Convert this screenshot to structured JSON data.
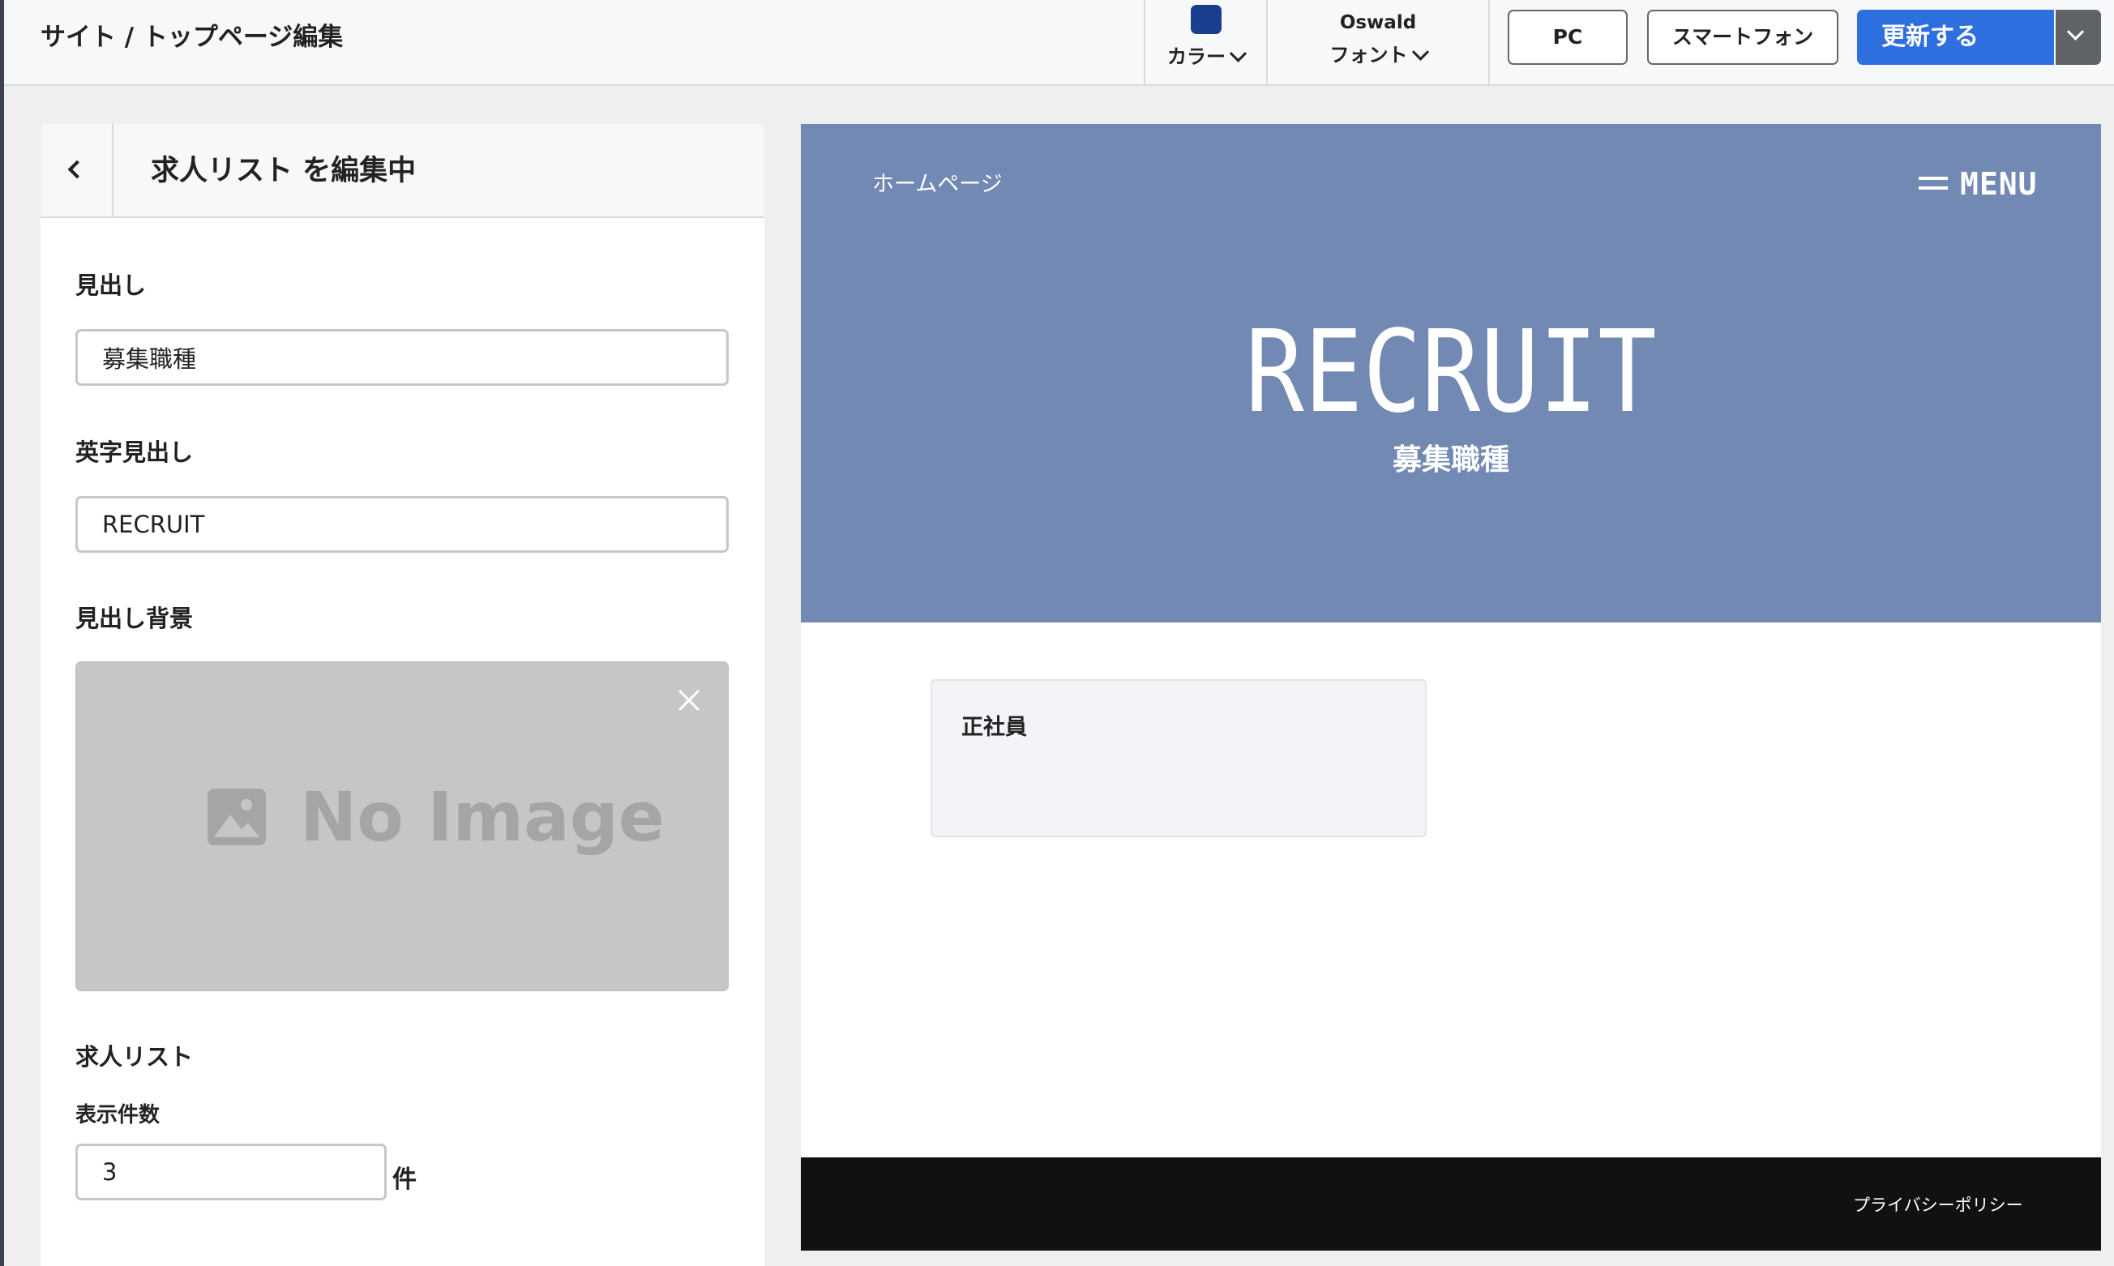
{
  "toolbar": {
    "breadcrumb": "サイト / トップページ編集",
    "color_label": "カラー",
    "color_swatch": "#1b3f8f",
    "font_name": "Oswald",
    "font_label": "フォント",
    "pc_label": "PC",
    "smartphone_label": "スマートフォン",
    "update_label": "更新する",
    "accent_color": "#2e6fe0"
  },
  "panel": {
    "title": "求人リスト を編集中",
    "heading_label": "見出し",
    "heading_value": "募集職種",
    "english_heading_label": "英字見出し",
    "english_heading_value": "RECRUIT",
    "background_label": "見出し背景",
    "no_image_text": "No Image",
    "list_label": "求人リスト",
    "count_label": "表示件数",
    "count_value": "3",
    "count_unit": "件"
  },
  "preview": {
    "home_link": "ホームページ",
    "menu_label": "MENU",
    "title": "RECRUIT",
    "subtitle": "募集職種",
    "hero_color": "#7289b3",
    "job_card_title": "正社員",
    "footer_link": "プライバシーポリシー"
  }
}
